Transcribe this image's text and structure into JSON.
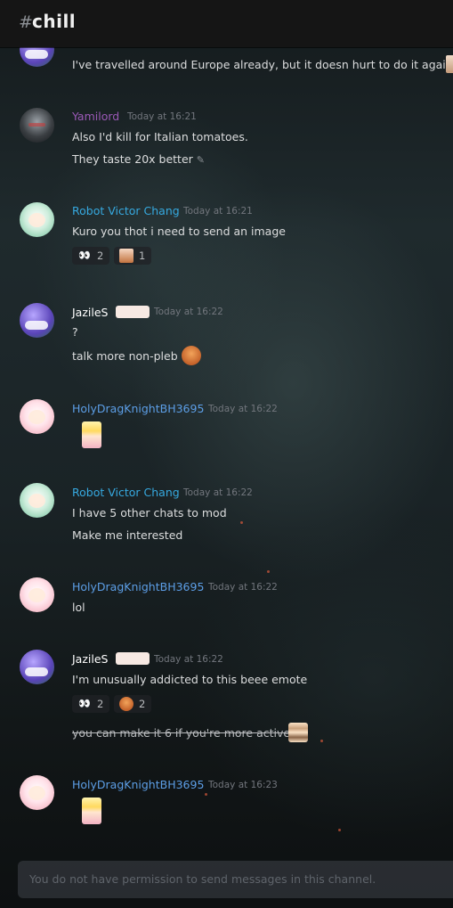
{
  "channel": {
    "hash": "#",
    "name": "chill"
  },
  "colors": {
    "header_bg": "#151515",
    "text_normal": "#dcddde",
    "timestamp": "#72767d",
    "yamilord": "#9b59b6",
    "robot": "#36a9e0",
    "holydrag": "#5c9ee6",
    "jazile": "#ffffff"
  },
  "messages": [
    {
      "lines": [
        "I've travelled around Europe already, but it doesn hurt to do it again"
      ],
      "avatar": "jazile-avatar"
    },
    {
      "author": "Yamilord",
      "time": "Today at 16:21",
      "lines": [
        "Also I'd kill for Italian tomatoes.",
        "They taste 20x better"
      ]
    },
    {
      "author": "Robot Victor Chang",
      "time": "Today at 16:21",
      "lines": [
        "Kuro you thot i need to send an image"
      ],
      "reactions": [
        {
          "emoji": "eyes",
          "glyph": "👀",
          "count": "2"
        },
        {
          "emoji": "custom-emote",
          "glyph": "",
          "count": "1"
        }
      ]
    },
    {
      "author": "JazileS",
      "time": "Today at 16:22",
      "lines": [
        "?",
        "talk more non-pleb"
      ]
    },
    {
      "author": "HolyDragKnightBH3695",
      "time": "Today at 16:22"
    },
    {
      "author": "Robot Victor Chang",
      "time": "Today at 16:22",
      "lines": [
        "I have 5 other chats to mod",
        "Make me interested"
      ]
    },
    {
      "author": "HolyDragKnightBH3695",
      "time": "Today at 16:22",
      "lines": [
        "lol"
      ]
    },
    {
      "author": "JazileS",
      "time": "Today at 16:22",
      "lines": [
        "I'm unusually addicted to this beee emote",
        "you can make it 6 if you're more active"
      ],
      "reactions": [
        {
          "emoji": "eyes",
          "glyph": "👀",
          "count": "2"
        },
        {
          "emoji": "custom-emote",
          "glyph": "",
          "count": "2"
        }
      ]
    },
    {
      "author": "HolyDragKnightBH3695",
      "time": "Today at 16:23"
    }
  ],
  "input": {
    "placeholder": "You do not have permission to send messages in this channel."
  }
}
